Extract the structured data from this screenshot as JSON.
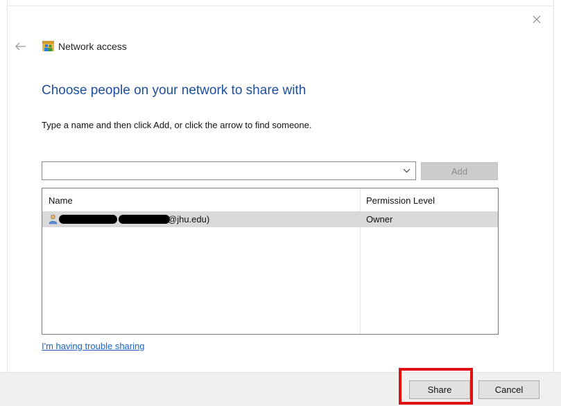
{
  "window": {
    "title": "Network access",
    "back_icon": "arrow-left-icon",
    "close_icon": "close-icon",
    "app_icon": "network-people-icon"
  },
  "main": {
    "heading": "Choose people on your network to share with",
    "instructions": "Type a name and then click Add, or click the arrow to find someone.",
    "name_input": {
      "value": "",
      "placeholder": ""
    },
    "dropdown_icon": "chevron-down-icon",
    "add_label": "Add",
    "add_enabled": false
  },
  "table": {
    "columns": [
      "Name",
      "Permission Level"
    ],
    "rows": [
      {
        "icon": "user-icon",
        "name_visible": "@jhu.edu)",
        "name_redacted": true,
        "permission": "Owner",
        "selected": true
      }
    ]
  },
  "links": {
    "trouble": "I'm having trouble sharing"
  },
  "footer": {
    "share_label": "Share",
    "cancel_label": "Cancel",
    "highlight_target": "share-button"
  },
  "colors": {
    "heading": "#1f4e9c",
    "link": "#1a64c8",
    "highlight": "#e01010",
    "selected_row": "#d9d9d9",
    "footer_bg": "#f0f0f0"
  }
}
